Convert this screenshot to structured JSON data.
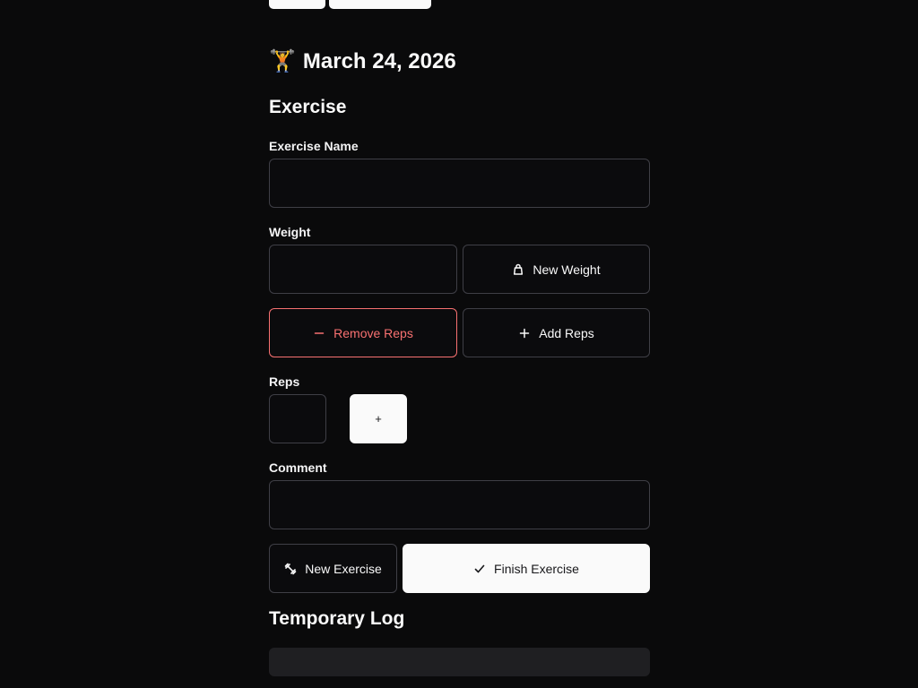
{
  "header": {
    "title_emoji": "🏋",
    "date_title": "March 24, 2026"
  },
  "exercise": {
    "heading": "Exercise",
    "name_label": "Exercise Name",
    "name_value": "",
    "weight_label": "Weight",
    "weight_value": "",
    "new_weight_label": "New Weight",
    "remove_reps_label": "Remove Reps",
    "add_reps_label": "Add Reps",
    "reps_label": "Reps",
    "reps_value": "",
    "reps_add_symbol": "+",
    "comment_label": "Comment",
    "comment_value": "",
    "new_exercise_label": "New Exercise",
    "finish_exercise_label": "Finish Exercise"
  },
  "log": {
    "heading": "Temporary Log"
  },
  "icons": {
    "weight": "kettlebell-icon",
    "remove": "minus-icon",
    "add": "plus-icon",
    "new_exercise": "dumbbell-icon",
    "finish": "check-icon"
  },
  "colors": {
    "background": "#0a0a0b",
    "border": "#3f3f46",
    "danger": "#f87171",
    "primary_button": "#fafafa",
    "log_panel": "#1f1f22"
  }
}
